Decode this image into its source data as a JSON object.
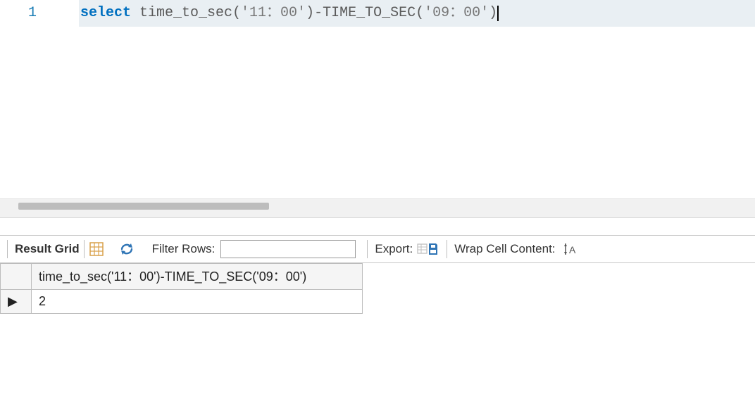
{
  "editor": {
    "line_no": "1",
    "kw_select": "select",
    "seg1": " time_to_sec(",
    "str1": "'11：00'",
    "seg2": ")-TIME_TO_SEC(",
    "str2": "'09：00'",
    "seg3": ")"
  },
  "toolbar": {
    "result_grid": "Result Grid",
    "filter_rows": "Filter Rows:",
    "filter_value": "",
    "export": "Export:",
    "wrap": "Wrap Cell Content:"
  },
  "grid": {
    "header": "time_to_sec('11：00')-TIME_TO_SEC('09：00')",
    "row_marker": "▶",
    "value": "2"
  }
}
